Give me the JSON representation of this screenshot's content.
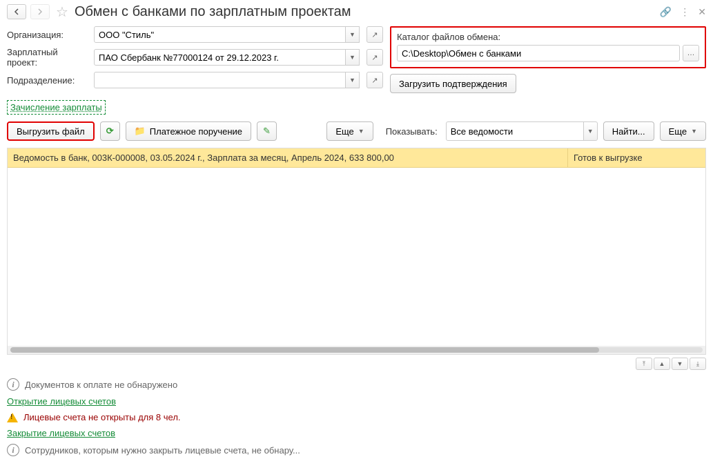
{
  "title": "Обмен с банками по зарплатным проектам",
  "fields": {
    "org_label": "Организация:",
    "org_value": "ООО \"Стиль\"",
    "project_label": "Зарплатный проект:",
    "project_value": "ПАО Сбербанк №77000124 от 29.12.2023 г.",
    "dept_label": "Подразделение:",
    "dept_value": ""
  },
  "catalog": {
    "label": "Каталог файлов обмена:",
    "value": "C:\\Desktop\\Обмен с банками"
  },
  "buttons": {
    "load_confirm": "Загрузить подтверждения",
    "tab_label": "Зачисление зарплаты",
    "export_file": "Выгрузить файл",
    "payment_order": "Платежное поручение",
    "more": "Еще",
    "find": "Найти...",
    "show_label": "Показывать:",
    "show_value": "Все ведомости"
  },
  "grid": {
    "row1_main": "Ведомость в банк, 003К-000008, 03.05.2024 г., Зарплата за месяц, Апрель 2024, 633 800,00",
    "row1_status": "Готов к выгрузке"
  },
  "info": {
    "no_docs": "Документов к оплате не обнаружено",
    "open_accounts": "Открытие лицевых счетов",
    "accounts_not_open": "Лицевые счета не открыты для 8 чел.",
    "close_accounts": "Закрытие лицевых счетов",
    "close_hint": "Сотрудников, которым нужно закрыть лицевые счета, не обнару..."
  }
}
